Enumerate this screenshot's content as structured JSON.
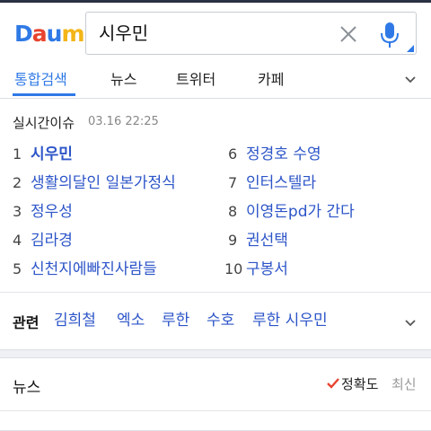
{
  "app": {
    "logo_letters": [
      "D",
      "a",
      "u",
      "m"
    ],
    "logo_colors": [
      "#2f79e6",
      "#e8432e",
      "#2f79e6",
      "#f3b517"
    ],
    "accent_color": "#2f79e6",
    "link_color": "#2d55c8"
  },
  "search": {
    "query": "시우민",
    "clear_icon": "close-icon",
    "voice_icon": "mic-icon"
  },
  "tabs": {
    "items": [
      "통합검색",
      "뉴스",
      "트위터",
      "카페"
    ],
    "active_index": 0
  },
  "realtime": {
    "title": "실시간이슈",
    "timestamp": "03.16 22:25",
    "ranks": [
      {
        "num": "1",
        "text": "시우민"
      },
      {
        "num": "2",
        "text": "생활의달인 일본가정식"
      },
      {
        "num": "3",
        "text": "정우성"
      },
      {
        "num": "4",
        "text": "김라경"
      },
      {
        "num": "5",
        "text": "신천지에빠진사람들"
      },
      {
        "num": "6",
        "text": "정경호 수영"
      },
      {
        "num": "7",
        "text": "인터스텔라"
      },
      {
        "num": "8",
        "text": "이영돈pd가 간다"
      },
      {
        "num": "9",
        "text": "권선택"
      },
      {
        "num": "10",
        "text": "구봉서"
      }
    ]
  },
  "related": {
    "label": "관련",
    "items": [
      "김희철",
      "엑소",
      "루한",
      "수호",
      "루한 시우민"
    ]
  },
  "news": {
    "title": "뉴스",
    "sort_accuracy": "정확도",
    "sort_latest": "최신"
  }
}
